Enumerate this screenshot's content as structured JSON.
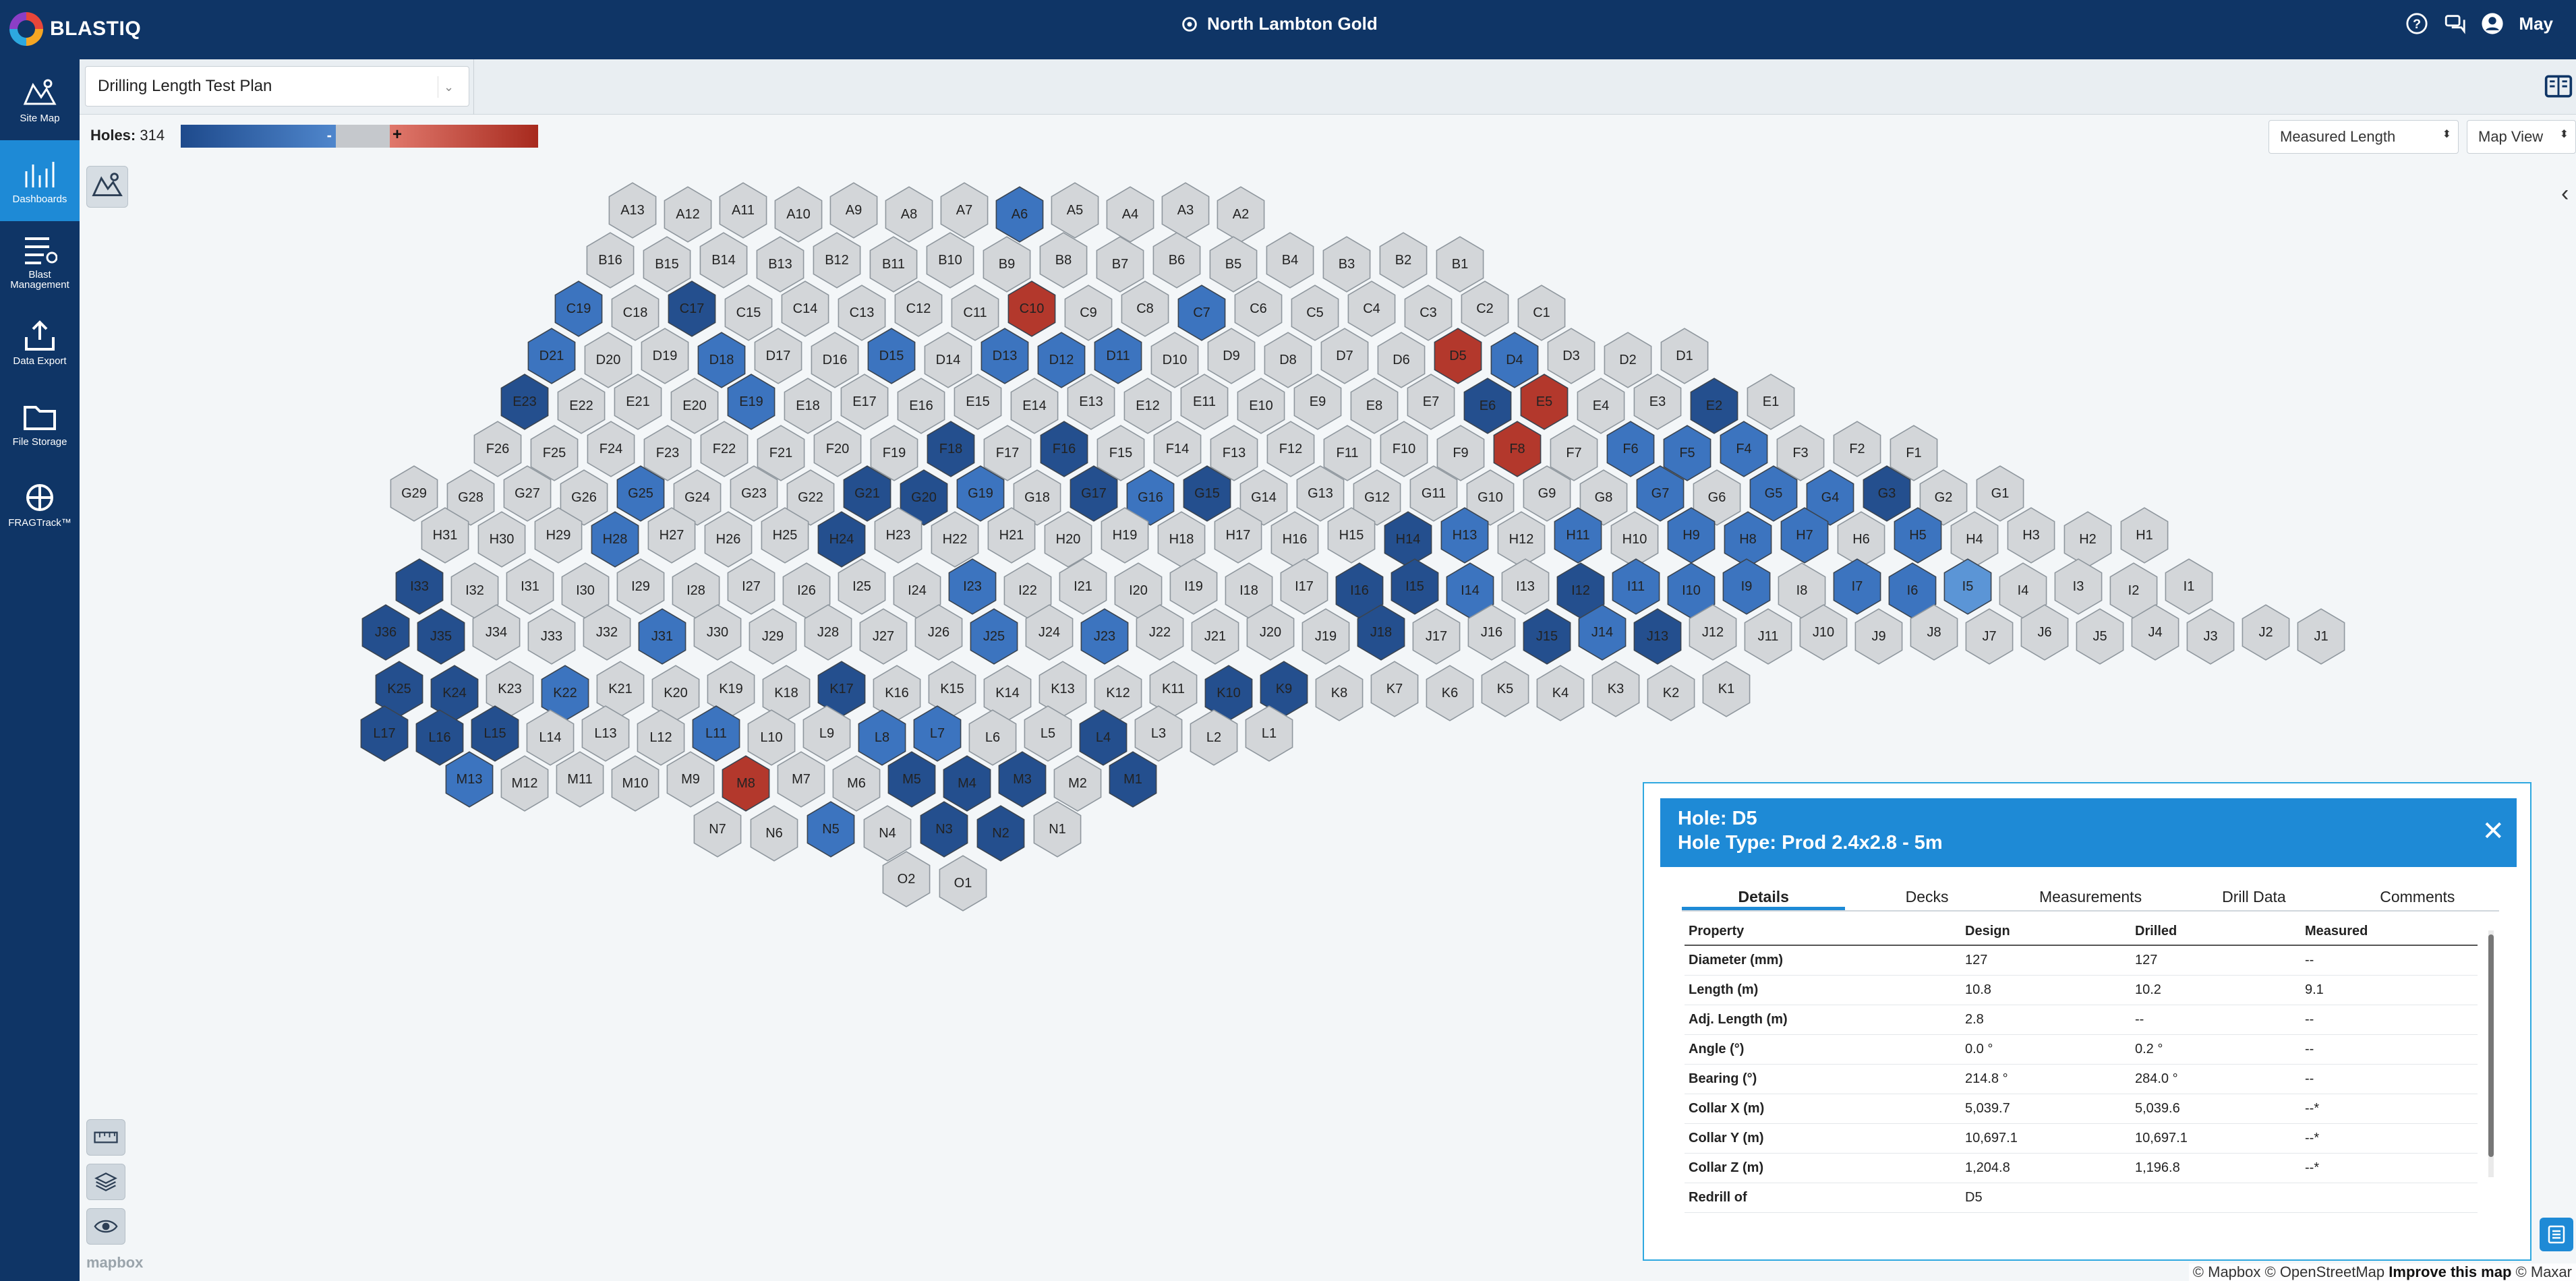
{
  "app": {
    "logo_text": "BLASTIQ",
    "site_name": "North Lambton Gold",
    "user": "May"
  },
  "nav": [
    {
      "label": "Site Map",
      "icon": "site-map-icon",
      "active": false
    },
    {
      "label": "Dashboards",
      "icon": "dashboard-icon",
      "active": true
    },
    {
      "label": "Blast Management",
      "icon": "blast-management-icon",
      "active": false
    },
    {
      "label": "Data Export",
      "icon": "export-icon",
      "active": false
    },
    {
      "label": "File Storage",
      "icon": "folder-icon",
      "active": false
    },
    {
      "label": "FRAGTrack™",
      "icon": "fragtrack-icon",
      "active": false
    }
  ],
  "toolbar": {
    "plan": "Drilling Length Test Plan",
    "holes_label": "Holes:",
    "holes_count": "314",
    "neg": "-",
    "pos": "+",
    "measure_select": "Measured Length",
    "view_select": "Map View"
  },
  "colors": {
    "gray": "#d3d6d9",
    "light_blue": "#5b95d6",
    "mid_blue": "#3c74bf",
    "dark_blue": "#244f8e",
    "red": "#b3382c",
    "nav": "#0f3566",
    "accent": "#1e8ad6"
  },
  "map": {
    "rows": [
      {
        "labels": [
          "A13",
          "A12",
          "A11",
          "A10",
          "A9",
          "A8",
          "A7",
          "A6",
          "A5",
          "A4",
          "A3",
          "A2"
        ],
        "colors": [
          "g",
          "g",
          "g",
          "g",
          "g",
          "g",
          "g",
          "m",
          "g",
          "g",
          "g",
          "g"
        ]
      },
      {
        "labels": [
          "B16",
          "B15",
          "B14",
          "B13",
          "B12",
          "B11",
          "B10",
          "B9",
          "B8",
          "B7",
          "B6",
          "B5",
          "B4",
          "B3",
          "B2",
          "B1"
        ],
        "colors": [
          "g",
          "g",
          "g",
          "g",
          "g",
          "g",
          "g",
          "g",
          "g",
          "g",
          "g",
          "g",
          "g",
          "g",
          "g",
          "g"
        ]
      },
      {
        "labels": [
          "C19",
          "C18",
          "C17",
          "C15",
          "C14",
          "C13",
          "C12",
          "C11",
          "C10",
          "C9",
          "C8",
          "C7",
          "C6",
          "C5",
          "C4",
          "C3",
          "C2",
          "C1"
        ],
        "colors": [
          "m",
          "g",
          "d",
          "g",
          "g",
          "g",
          "g",
          "g",
          "r",
          "g",
          "g",
          "m",
          "g",
          "g",
          "g",
          "g",
          "g",
          "g"
        ]
      },
      {
        "labels": [
          "D21",
          "D20",
          "D19",
          "D18",
          "D17",
          "D16",
          "D15",
          "D14",
          "D13",
          "D12",
          "D11",
          "D10",
          "D9",
          "D8",
          "D7",
          "D6",
          "D5",
          "D4",
          "D3",
          "D2",
          "D1"
        ],
        "colors": [
          "m",
          "g",
          "g",
          "m",
          "g",
          "g",
          "m",
          "g",
          "m",
          "m",
          "m",
          "g",
          "g",
          "g",
          "g",
          "g",
          "r",
          "m",
          "g",
          "g",
          "g"
        ]
      },
      {
        "labels": [
          "E23",
          "E22",
          "E21",
          "E20",
          "E19",
          "E18",
          "E17",
          "E16",
          "E15",
          "E14",
          "E13",
          "E12",
          "E11",
          "E10",
          "E9",
          "E8",
          "E7",
          "E6",
          "E5",
          "E4",
          "E3",
          "E2",
          "E1"
        ],
        "colors": [
          "d",
          "g",
          "g",
          "g",
          "m",
          "g",
          "g",
          "g",
          "g",
          "g",
          "g",
          "g",
          "g",
          "g",
          "g",
          "g",
          "g",
          "d",
          "r",
          "g",
          "g",
          "d",
          "g"
        ]
      },
      {
        "labels": [
          "F26",
          "F25",
          "F24",
          "F23",
          "F22",
          "F21",
          "F20",
          "F19",
          "F18",
          "F17",
          "F16",
          "F15",
          "F14",
          "F13",
          "F12",
          "F11",
          "F10",
          "F9",
          "F8",
          "F7",
          "F6",
          "F5",
          "F4",
          "F3",
          "F2",
          "F1"
        ],
        "colors": [
          "g",
          "g",
          "g",
          "g",
          "g",
          "g",
          "g",
          "g",
          "d",
          "g",
          "d",
          "g",
          "g",
          "g",
          "g",
          "g",
          "g",
          "g",
          "r",
          "g",
          "m",
          "m",
          "m",
          "g",
          "g",
          "g"
        ]
      },
      {
        "labels": [
          "G29",
          "G28",
          "G27",
          "G26",
          "G25",
          "G24",
          "G23",
          "G22",
          "G21",
          "G20",
          "G19",
          "G18",
          "G17",
          "G16",
          "G15",
          "G14",
          "G13",
          "G12",
          "G11",
          "G10",
          "G9",
          "G8",
          "G7",
          "G6",
          "G5",
          "G4",
          "G3",
          "G2",
          "G1"
        ],
        "colors": [
          "g",
          "g",
          "g",
          "g",
          "m",
          "g",
          "g",
          "g",
          "d",
          "d",
          "m",
          "g",
          "d",
          "m",
          "d",
          "g",
          "g",
          "g",
          "g",
          "g",
          "g",
          "g",
          "m",
          "g",
          "m",
          "m",
          "d",
          "g",
          "g"
        ]
      },
      {
        "labels": [
          "H31",
          "H30",
          "H29",
          "H28",
          "H27",
          "H26",
          "H25",
          "H24",
          "H23",
          "H22",
          "H21",
          "H20",
          "H19",
          "H18",
          "H17",
          "H16",
          "H15",
          "H14",
          "H13",
          "H12",
          "H11",
          "H10",
          "H9",
          "H8",
          "H7",
          "H6",
          "H5",
          "H4",
          "H3",
          "H2",
          "H1"
        ],
        "colors": [
          "g",
          "g",
          "g",
          "m",
          "g",
          "g",
          "g",
          "d",
          "g",
          "g",
          "g",
          "g",
          "g",
          "g",
          "g",
          "g",
          "g",
          "d",
          "m",
          "g",
          "m",
          "g",
          "m",
          "m",
          "m",
          "g",
          "m",
          "g",
          "g",
          "g",
          "g"
        ]
      },
      {
        "labels": [
          "I33",
          "I32",
          "I31",
          "I30",
          "I29",
          "I28",
          "I27",
          "I26",
          "I25",
          "I24",
          "I23",
          "I22",
          "I21",
          "I20",
          "I19",
          "I18",
          "I17",
          "I16",
          "I15",
          "I14",
          "I13",
          "I12",
          "I11",
          "I10",
          "I9",
          "I8",
          "I7",
          "I6",
          "I5",
          "I4",
          "I3",
          "I2",
          "I1"
        ],
        "colors": [
          "d",
          "g",
          "g",
          "g",
          "g",
          "g",
          "g",
          "g",
          "g",
          "g",
          "m",
          "g",
          "g",
          "g",
          "g",
          "g",
          "g",
          "d",
          "d",
          "m",
          "g",
          "d",
          "m",
          "m",
          "m",
          "g",
          "m",
          "m",
          "l",
          "g",
          "g",
          "g",
          "g"
        ]
      },
      {
        "labels": [
          "J36",
          "J35",
          "J34",
          "J33",
          "J32",
          "J31",
          "J30",
          "J29",
          "J28",
          "J27",
          "J26",
          "J25",
          "J24",
          "J23",
          "J22",
          "J21",
          "J20",
          "J19",
          "J18",
          "J17",
          "J16",
          "J15",
          "J14",
          "J13",
          "J12",
          "J11",
          "J10",
          "J9",
          "J8",
          "J7",
          "J6",
          "J5",
          "J4",
          "J3",
          "J2",
          "J1"
        ],
        "colors": [
          "d",
          "d",
          "g",
          "g",
          "g",
          "m",
          "g",
          "g",
          "g",
          "g",
          "g",
          "m",
          "g",
          "m",
          "g",
          "g",
          "g",
          "g",
          "d",
          "g",
          "g",
          "d",
          "m",
          "d",
          "g",
          "g",
          "g",
          "g",
          "g",
          "g",
          "g",
          "g",
          "g",
          "g",
          "g",
          "g"
        ]
      },
      {
        "labels": [
          "K25",
          "K24",
          "K23",
          "K22",
          "K21",
          "K20",
          "K19",
          "K18",
          "K17",
          "K16",
          "K15",
          "K14",
          "K13",
          "K12",
          "K11",
          "K10",
          "K9",
          "K8",
          "K7",
          "K6",
          "K5",
          "K4",
          "K3",
          "K2",
          "K1"
        ],
        "colors": [
          "d",
          "d",
          "g",
          "m",
          "g",
          "g",
          "g",
          "g",
          "d",
          "g",
          "g",
          "g",
          "g",
          "g",
          "g",
          "d",
          "d",
          "g",
          "g",
          "g",
          "g",
          "g",
          "g",
          "g",
          "g"
        ]
      },
      {
        "labels": [
          "L17",
          "L16",
          "L15",
          "L14",
          "L13",
          "L12",
          "L11",
          "L10",
          "L9",
          "L8",
          "L7",
          "L6",
          "L5",
          "L4",
          "L3",
          "L2",
          "L1"
        ],
        "colors": [
          "d",
          "d",
          "d",
          "g",
          "g",
          "g",
          "m",
          "g",
          "g",
          "m",
          "m",
          "g",
          "g",
          "d",
          "g",
          "g",
          "g"
        ]
      },
      {
        "labels": [
          "M13",
          "M12",
          "M11",
          "M10",
          "M9",
          "M8",
          "M7",
          "M6",
          "M5",
          "M4",
          "M3",
          "M2",
          "M1"
        ],
        "colors": [
          "m",
          "g",
          "g",
          "g",
          "g",
          "r",
          "g",
          "g",
          "d",
          "d",
          "d",
          "g",
          "d"
        ]
      },
      {
        "labels": [
          "N7",
          "N6",
          "N5",
          "N4",
          "N3",
          "N2",
          "N1"
        ],
        "colors": [
          "g",
          "g",
          "m",
          "g",
          "d",
          "d",
          "g"
        ]
      },
      {
        "labels": [
          "O2",
          "O1"
        ],
        "colors": [
          "g",
          "g"
        ]
      }
    ]
  },
  "panel": {
    "hole": "Hole: D5",
    "type": "Hole Type: Prod 2.4x2.8 - 5m",
    "tabs": [
      "Details",
      "Decks",
      "Measurements",
      "Drill Data",
      "Comments"
    ],
    "headers": [
      "Property",
      "Design",
      "Drilled",
      "Measured"
    ],
    "rows": [
      [
        "Diameter (mm)",
        "127",
        "127",
        "--"
      ],
      [
        "Length (m)",
        "10.8",
        "10.2",
        "9.1"
      ],
      [
        "Adj. Length (m)",
        "2.8",
        "--",
        "--"
      ],
      [
        "Angle (°)",
        "0.0 °",
        "0.2 °",
        "--"
      ],
      [
        "Bearing (°)",
        "214.8 °",
        "284.0 °",
        "--"
      ],
      [
        "Collar X (m)",
        "5,039.7",
        "5,039.6",
        "--*"
      ],
      [
        "Collar Y (m)",
        "10,697.1",
        "10,697.1",
        "--*"
      ],
      [
        "Collar Z (m)",
        "1,204.8",
        "1,196.8",
        "--*"
      ],
      [
        "Redrill of",
        "D5",
        "",
        ""
      ]
    ]
  },
  "footer": {
    "mapbox": "mapbox",
    "attribution_a": "© Mapbox © OpenStreetMap",
    "attribution_b": "Improve this map",
    "attribution_c": "© Maxar"
  }
}
